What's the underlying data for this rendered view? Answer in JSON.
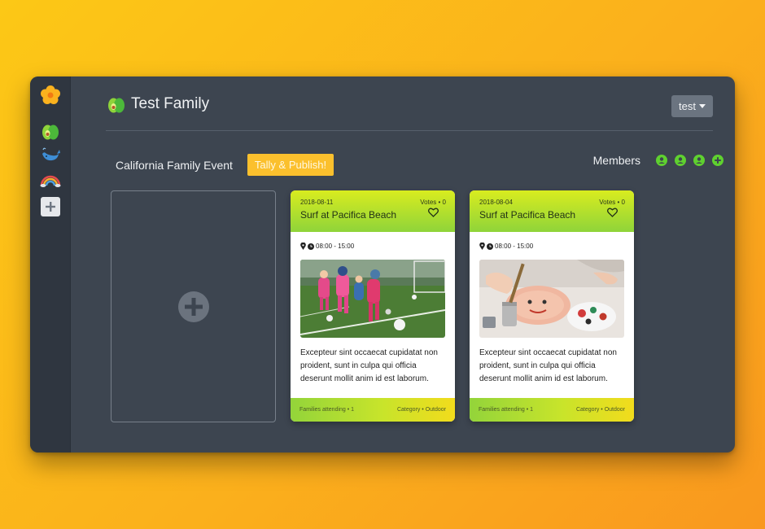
{
  "sidebar": {
    "items": [
      {
        "name": "flower-logo-icon"
      },
      {
        "name": "avocado-icon"
      },
      {
        "name": "whale-icon"
      },
      {
        "name": "rainbow-icon"
      },
      {
        "name": "plus-icon"
      }
    ]
  },
  "header": {
    "family_name": "Test Family",
    "user_menu_label": "test"
  },
  "event": {
    "title": "California Family Event",
    "tally_label": "Tally & Publish!"
  },
  "members": {
    "label": "Members",
    "count": 3,
    "accent": "#5fd12f"
  },
  "cards": [
    {
      "date": "2018-08-11",
      "votes": "Votes • 0",
      "title": "Surf at Pacifica Beach",
      "time": "08:00 - 15:00",
      "photo": "soccer-kids-photo",
      "description": "Excepteur sint occaecat cupidatat non proident, sunt in culpa qui officia deserunt mollit anim id est laborum.",
      "families": "Families attending • 1",
      "category": "Category • Outdoor"
    },
    {
      "date": "2018-08-04",
      "votes": "Votes • 0",
      "title": "Surf at Pacifica Beach",
      "time": "08:00 - 15:00",
      "photo": "painting-crafts-photo",
      "description": "Excepteur sint occaecat cupidatat non proident, sunt in culpa qui officia deserunt mollit anim id est laborum.",
      "families": "Families attending • 1",
      "category": "Category • Outdoor"
    }
  ]
}
